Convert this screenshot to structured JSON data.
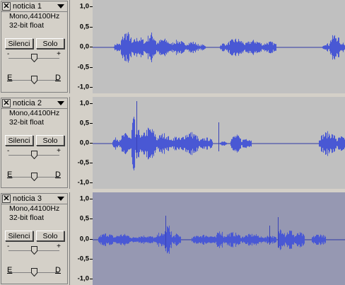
{
  "ruler_labels": [
    "1,0",
    "0,5",
    "0,0",
    "-0,5",
    "-1,0"
  ],
  "colors": {
    "wave_bg": "#c0c0c0",
    "wave_bg_selected": "#9698b2",
    "waveform": "#4958d4",
    "waveform_dark": "#3942b8",
    "center_line": "#2f37a6"
  },
  "tracks": [
    {
      "name": "noticia 1",
      "format": "Mono,44100Hz",
      "bits": "32-bit float",
      "mute_label": "Silenci",
      "solo_label": "Solo",
      "gain_minus": "-",
      "gain_plus": "+",
      "pan_left": "E",
      "pan_right": "D",
      "selected": false
    },
    {
      "name": "noticia 2",
      "format": "Mono,44100Hz",
      "bits": "32-bit float",
      "mute_label": "Silenci",
      "solo_label": "Solo",
      "gain_minus": "-",
      "gain_plus": "+",
      "pan_left": "E",
      "pan_right": "D",
      "selected": false
    },
    {
      "name": "noticia 3",
      "format": "Mono,44100Hz",
      "bits": "32-bit float",
      "mute_label": "Silenci",
      "solo_label": "Solo",
      "gain_minus": "-",
      "gain_plus": "+",
      "pan_left": "E",
      "pan_right": "D",
      "selected": true
    }
  ]
}
